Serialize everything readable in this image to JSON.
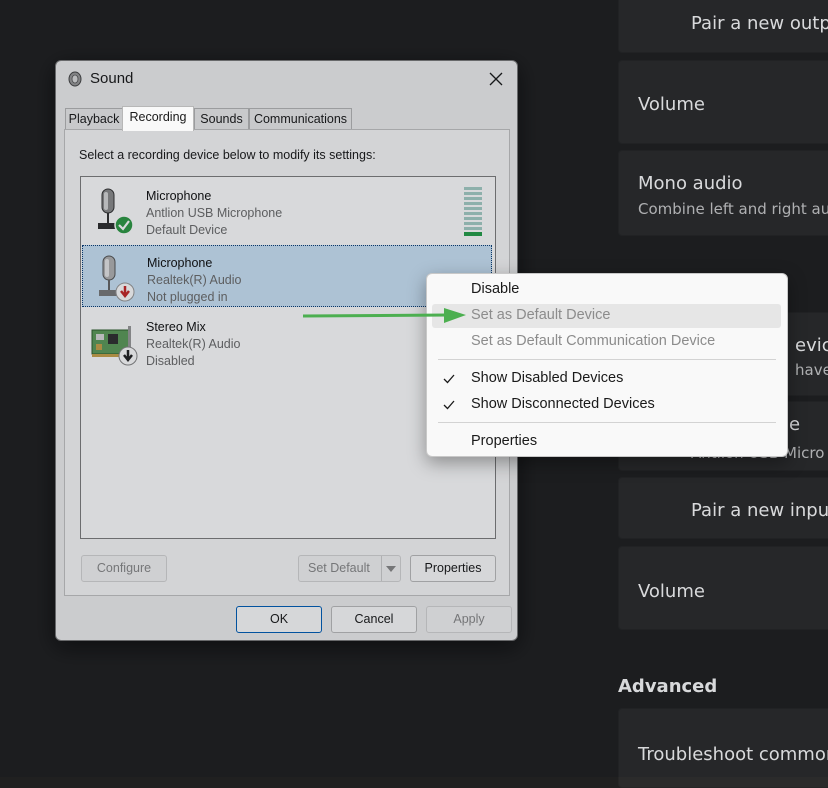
{
  "settings_panel": {
    "cards": [
      {
        "title": "Pair a new outpu",
        "subtitle": ""
      },
      {
        "title": "Volume",
        "subtitle": ""
      },
      {
        "title": "Mono audio",
        "subtitle": "Combine left and right au"
      },
      {
        "title": "evice",
        "subtitle": "have t"
      },
      {
        "title": "e",
        "subtitle": "Antlion USB Micro"
      },
      {
        "title": "Pair a new input",
        "subtitle": ""
      },
      {
        "title": "Volume",
        "subtitle": ""
      },
      {
        "title": "Troubleshoot commor",
        "subtitle": ""
      }
    ],
    "advanced_heading": "Advanced"
  },
  "dialog": {
    "title": "Sound",
    "tabs": [
      "Playback",
      "Recording",
      "Sounds",
      "Communications"
    ],
    "active_tab": "Recording",
    "instruction": "Select a recording device below to modify its settings:",
    "devices": [
      {
        "name": "Microphone",
        "description": "Antlion USB Microphone",
        "status": "Default Device",
        "badge": "check-badge-icon"
      },
      {
        "name": "Microphone",
        "description": "Realtek(R) Audio",
        "status": "Not plugged in",
        "badge": "down-arrow-red-badge-icon"
      },
      {
        "name": "Stereo Mix",
        "description": "Realtek(R) Audio",
        "status": "Disabled",
        "badge": "down-arrow-black-badge-icon"
      }
    ],
    "buttons": {
      "configure": "Configure",
      "set_default": "Set Default",
      "properties": "Properties",
      "ok": "OK",
      "cancel": "Cancel",
      "apply": "Apply"
    }
  },
  "context_menu": {
    "items": [
      {
        "label": "Disable",
        "enabled": true,
        "checked": false
      },
      {
        "label": "Set as Default Device",
        "enabled": false,
        "checked": false,
        "highlighted": true
      },
      {
        "label": "Set as Default Communication Device",
        "enabled": false,
        "checked": false
      },
      {
        "label": "Show Disabled Devices",
        "enabled": true,
        "checked": true
      },
      {
        "label": "Show Disconnected Devices",
        "enabled": true,
        "checked": true
      },
      {
        "label": "Properties",
        "enabled": true,
        "checked": false
      }
    ]
  },
  "colors": {
    "annotation_arrow": "#4caf50",
    "selection": "#cce4f7",
    "settings_bg": "#202020",
    "card_bg": "#2b2b2b"
  }
}
